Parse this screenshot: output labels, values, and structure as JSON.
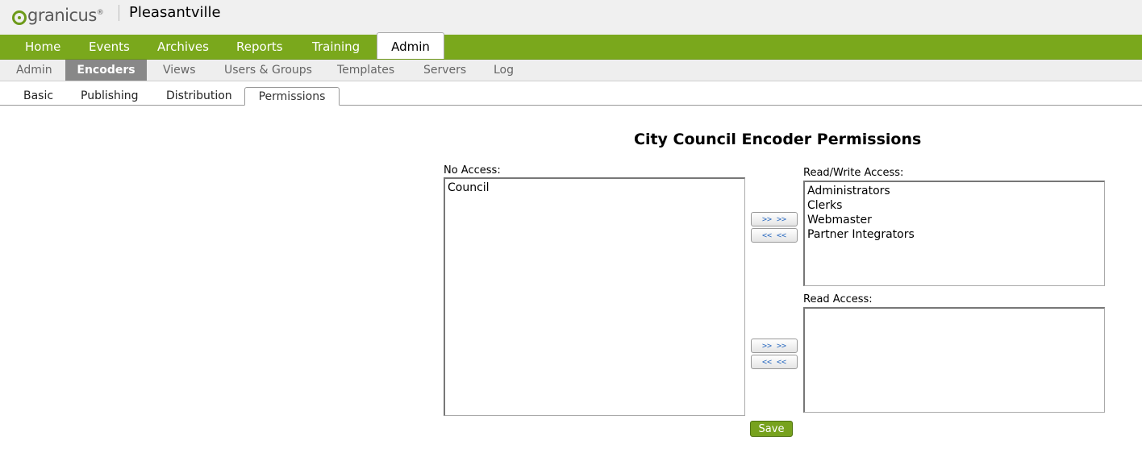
{
  "header": {
    "logo_text": "granicus",
    "logo_mark": "®",
    "site_name": "Pleasantville"
  },
  "main_nav": {
    "tabs": [
      "Home",
      "Events",
      "Archives",
      "Reports",
      "Training",
      "Admin"
    ],
    "active": "Admin"
  },
  "sub_nav": {
    "tabs": [
      "Admin",
      "Encoders",
      "Views",
      "Users & Groups",
      "Templates",
      "Servers",
      "Log"
    ],
    "active": "Encoders"
  },
  "tert_nav": {
    "tabs": [
      "Basic",
      "Publishing",
      "Distribution",
      "Permissions"
    ],
    "active": "Permissions"
  },
  "page": {
    "title": "City Council Encoder Permissions",
    "no_access_label": "No Access:",
    "no_access_items": [
      "Council"
    ],
    "rw_label": "Read/Write Access:",
    "rw_items": [
      "Administrators",
      "Clerks",
      "Webmaster",
      "Partner Integrators"
    ],
    "read_label": "Read Access:",
    "read_items": [],
    "move_right": ">> >>",
    "move_left": "<< <<",
    "save_label": "Save"
  },
  "colors": {
    "brand_green": "#7aa81c",
    "button_text_blue": "#2a6ac0"
  }
}
